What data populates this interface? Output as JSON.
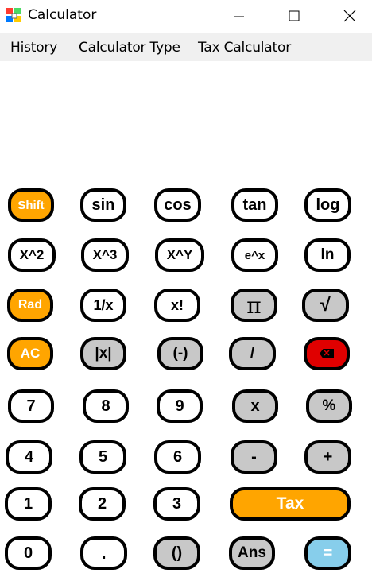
{
  "window": {
    "title": "Calculator",
    "icons": {
      "app": "calculator-app-icon",
      "minimize": "minimize-icon",
      "maximize": "maximize-icon",
      "close": "close-icon"
    }
  },
  "menu": {
    "items": [
      "History",
      "Calculator Type",
      "Tax Calculator"
    ]
  },
  "display": {
    "value": ""
  },
  "keypad": {
    "rows": [
      [
        "Shift",
        "sin",
        "cos",
        "tan",
        "log"
      ],
      [
        "X^2",
        "X^3",
        "X^Y",
        "e^x",
        "ln"
      ],
      [
        "Rad",
        "1/x",
        "x!",
        "π",
        "√"
      ],
      [
        "AC",
        "|x|",
        "(-)",
        "/",
        "backspace"
      ],
      [
        "7",
        "8",
        "9",
        "x",
        "%"
      ],
      [
        "4",
        "5",
        "6",
        "-",
        "+"
      ],
      [
        "1",
        "2",
        "3",
        "Tax"
      ],
      [
        "0",
        ".",
        "()",
        "Ans",
        "="
      ]
    ]
  },
  "colors": {
    "orange": "#ffa500",
    "gray": "#c8c8c8",
    "blue": "#87ceeb",
    "red": "#e00000",
    "menubar": "#f0f0f0"
  }
}
